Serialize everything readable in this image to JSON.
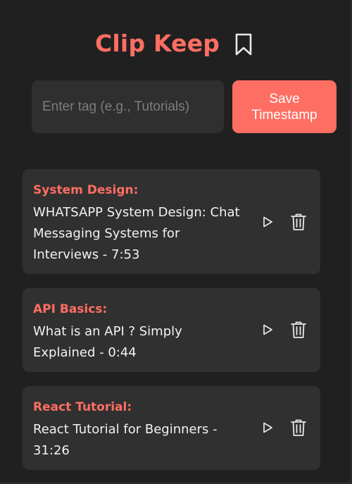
{
  "app": {
    "title": "Clip Keep",
    "accent_color": "#ff6e62",
    "background_color": "#202020",
    "card_color": "#303030"
  },
  "header": {
    "bookmark_icon": "bookmark-icon"
  },
  "form": {
    "tag_placeholder": "Enter tag (e.g., Tutorials)",
    "tag_value": "",
    "save_label": "Save Timestamp"
  },
  "timestamps": [
    {
      "tag": "System Design:",
      "title": "WHATSAPP System Design: Chat Messaging Systems for Interviews - 7:53",
      "play_icon": "play-icon",
      "delete_icon": "trash-icon"
    },
    {
      "tag": "API Basics:",
      "title": "What is an API ? Simply Explained - 0:44",
      "play_icon": "play-icon",
      "delete_icon": "trash-icon"
    },
    {
      "tag": "React Tutorial:",
      "title": "React Tutorial for Beginners - 31:26",
      "play_icon": "play-icon",
      "delete_icon": "trash-icon"
    }
  ]
}
